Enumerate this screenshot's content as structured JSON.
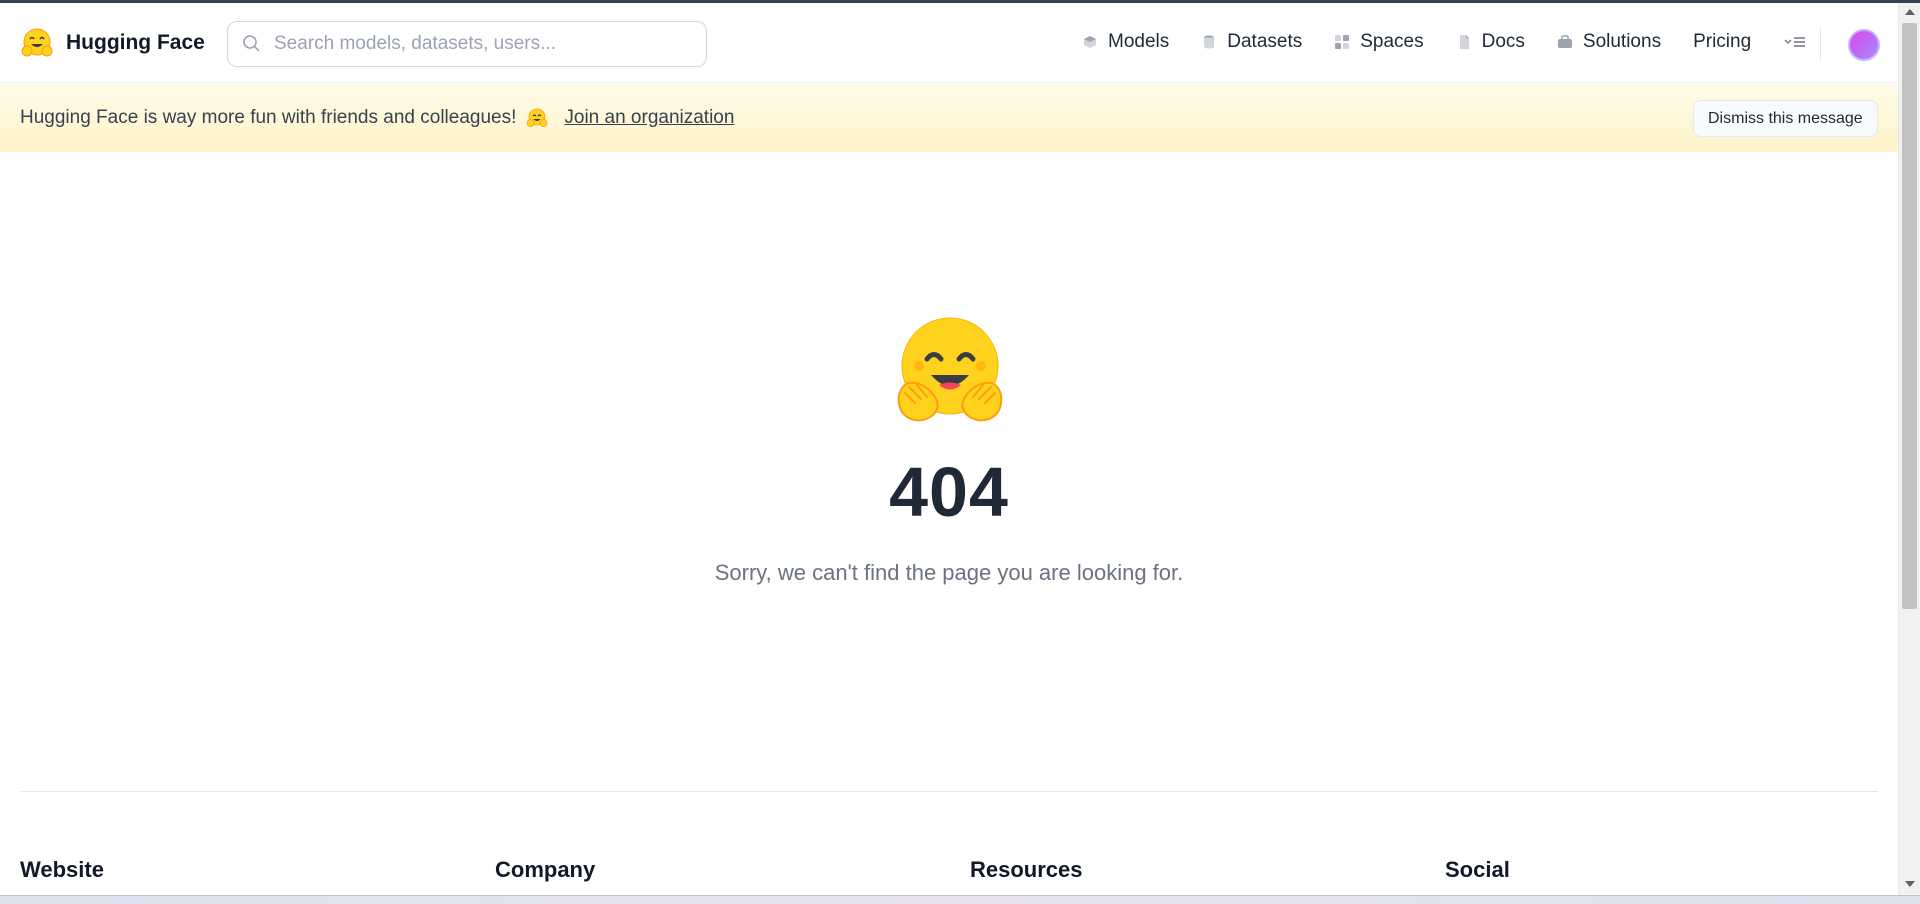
{
  "app": {
    "brand_name": "Hugging Face"
  },
  "search": {
    "placeholder": "Search models, datasets, users..."
  },
  "nav": {
    "items": [
      {
        "label": "Models",
        "icon": "models-icon",
        "color": "#6b7280"
      },
      {
        "label": "Datasets",
        "icon": "datasets-icon",
        "color": "#9ca3af"
      },
      {
        "label": "Spaces",
        "icon": "spaces-icon",
        "color": "#9ca3af"
      },
      {
        "label": "Docs",
        "icon": "docs-icon",
        "color": "#9ca3af"
      },
      {
        "label": "Solutions",
        "icon": "solutions-icon",
        "color": "#9ca3af"
      },
      {
        "label": "Pricing"
      }
    ]
  },
  "banner": {
    "text": "Hugging Face is way more fun with friends and colleagues!",
    "link": "Join an organization",
    "dismiss_label": "Dismiss this message"
  },
  "error": {
    "code": "404",
    "message": "Sorry, we can't find the page you are looking for."
  },
  "footer": {
    "columns": [
      "Website",
      "Company",
      "Resources",
      "Social"
    ]
  },
  "colors": {
    "banner_bg": "#fef3c7",
    "emoji_yellow": "#ffd21e",
    "heading": "#1f2937",
    "muted_text": "#6b7280"
  }
}
